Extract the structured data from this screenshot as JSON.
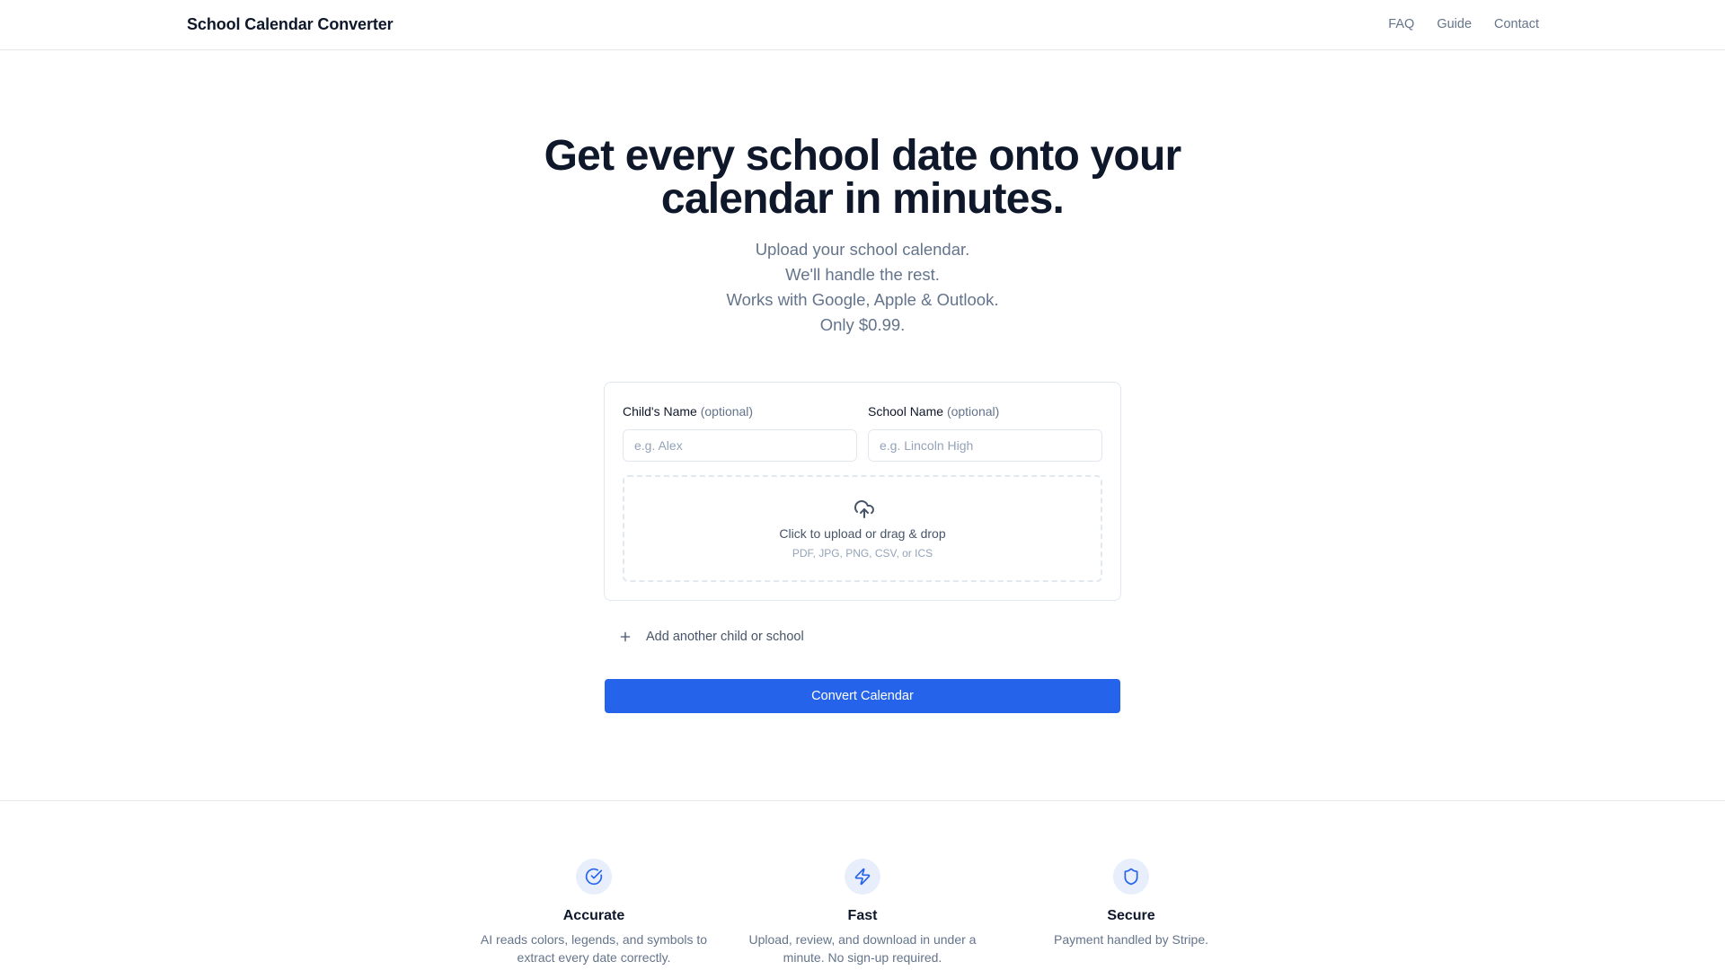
{
  "header": {
    "brand": "School Calendar Converter",
    "nav": [
      {
        "label": "FAQ"
      },
      {
        "label": "Guide"
      },
      {
        "label": "Contact"
      }
    ]
  },
  "hero": {
    "title_line1": "Get every school date onto your",
    "title_line2": "calendar in minutes.",
    "subtitle_lines": [
      "Upload your school calendar.",
      "We'll handle the rest.",
      "Works with Google, Apple & Outlook.",
      "Only $0.99."
    ]
  },
  "form": {
    "child": {
      "label": "Child's Name",
      "optional": "(optional)",
      "placeholder": "e.g. Alex",
      "value": ""
    },
    "school": {
      "label": "School Name",
      "optional": "(optional)",
      "placeholder": "e.g. Lincoln High",
      "value": ""
    },
    "upload": {
      "icon": "cloud-upload-icon",
      "main": "Click to upload or drag & drop",
      "hint": "PDF, JPG, PNG, CSV, or ICS"
    },
    "add_another": "Add another child or school",
    "convert_label": "Convert Calendar"
  },
  "features": [
    {
      "icon": "check-circle-icon",
      "title": "Accurate",
      "line1": "AI reads colors, legends, and symbols to",
      "line2": "extract every date correctly."
    },
    {
      "icon": "lightning-icon",
      "title": "Fast",
      "line1": "Upload, review, and download in under a",
      "line2": "minute. No sign-up required."
    },
    {
      "icon": "shield-icon",
      "title": "Secure",
      "line1": "Payment handled by Stripe.",
      "line2": ""
    }
  ],
  "colors": {
    "accent": "#2563eb",
    "text_primary": "#0f172a",
    "text_muted": "#64748b",
    "border": "#e2e8f0",
    "icon_bg": "#e8eefb"
  }
}
